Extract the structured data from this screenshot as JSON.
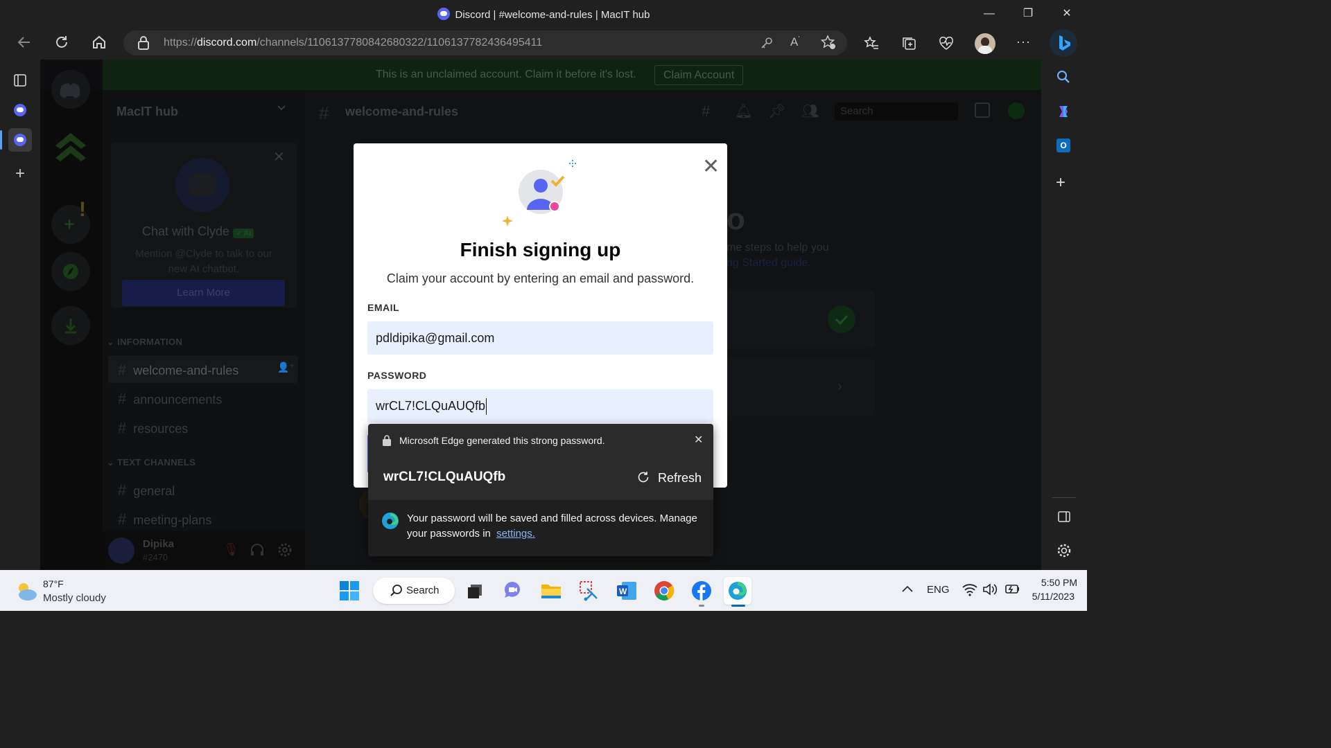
{
  "window": {
    "title": "Discord | #welcome-and-rules | MacIT hub",
    "minimize": "—",
    "restore": "❐",
    "close": "✕"
  },
  "browser": {
    "url_prefix": "https://",
    "url_domain": "discord.com",
    "url_path": "/channels/1106137780842680322/1106137782436495411",
    "read_aloud": "A̅ʼ",
    "more": "···"
  },
  "discord": {
    "banner_text": "This is an unclaimed account. Claim it before it's lost.",
    "claim_button": "Claim Account",
    "server_name": "MacIT hub",
    "header_channel": "welcome-and-rules",
    "search_placeholder": "Search",
    "clyde_title": "Chat with Clyde",
    "clyde_badge": "✓ AI",
    "clyde_desc_1": "Mention @Clyde to talk to our",
    "clyde_desc_2": "new AI chatbot.",
    "learn_more": "Learn More",
    "cat_information": "INFORMATION",
    "cat_text": "TEXT CHANNELS",
    "channels": [
      "welcome-and-rules",
      "announcements",
      "resources",
      "general",
      "meeting-plans"
    ],
    "user_name": "Dipika",
    "user_tag": "#2470",
    "bg_text_1": "me steps to help you",
    "bg_text_2": "ng Started guide.",
    "bg_glyph": "o"
  },
  "modal": {
    "title": "Finish signing up",
    "subtitle": "Claim your account by entering an email and password.",
    "email_label": "EMAIL",
    "email_value": "pdldipika@gmail.com",
    "password_label": "PASSWORD",
    "password_value": "wrCL7!CLQuAUQfb"
  },
  "password_popup": {
    "header": "Microsoft Edge generated this strong password.",
    "password": "wrCL7!CLQuAUQfb",
    "refresh": "Refresh",
    "info_line1": "Your password will be saved and filled across devices. Manage",
    "info_line2": "your passwords in",
    "settings_link": "settings."
  },
  "taskbar": {
    "temperature": "87°F",
    "weather": "Mostly cloudy",
    "search_label": "Search",
    "language": "ENG",
    "time": "5:50 PM",
    "date": "5/11/2023"
  },
  "colors": {
    "discord_blurple": "#5865f2",
    "edge_blue": "#0078d4",
    "link_blue": "#8ab4f8",
    "input_autofill": "#e8f0fe"
  }
}
